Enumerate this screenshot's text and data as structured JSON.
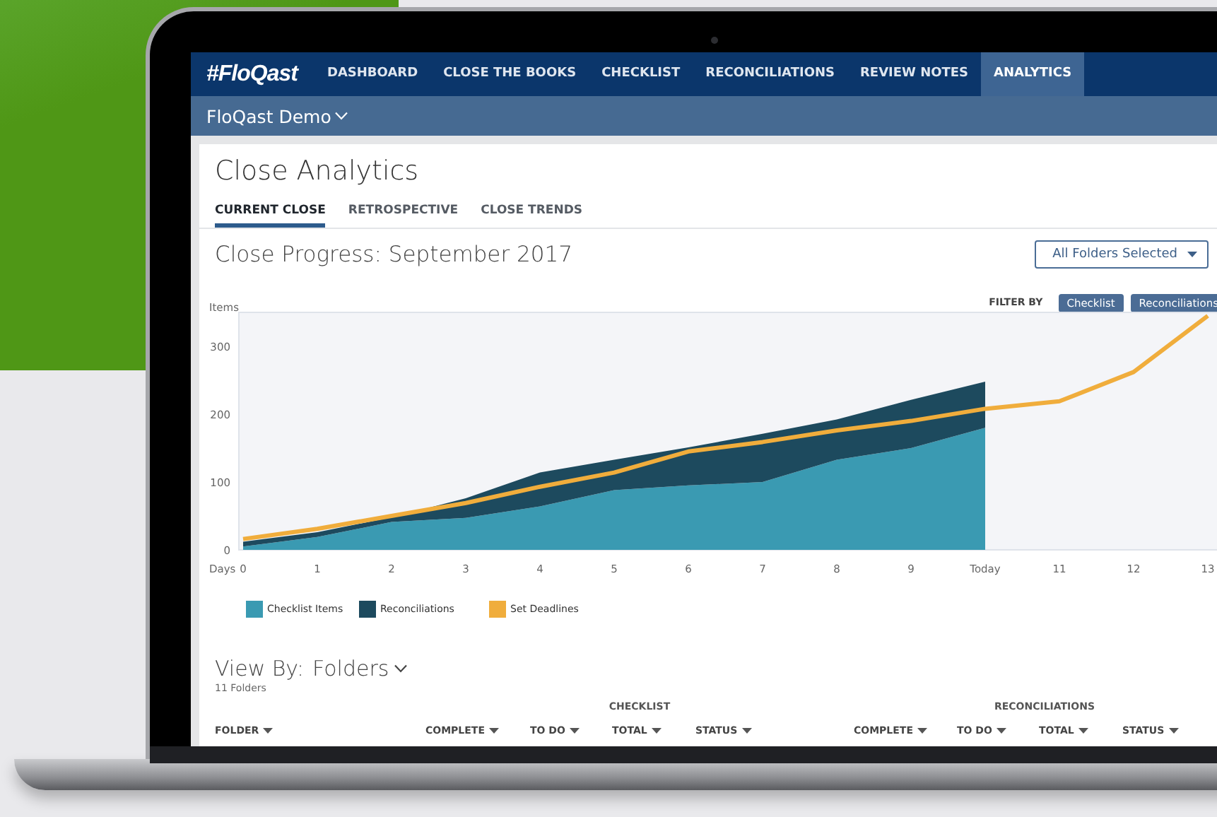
{
  "nav": {
    "logo": "#FloQast",
    "tabs": [
      {
        "label": "DASHBOARD",
        "selected": false
      },
      {
        "label": "CLOSE THE BOOKS",
        "selected": false
      },
      {
        "label": "CHECKLIST",
        "selected": false
      },
      {
        "label": "RECONCILIATIONS",
        "selected": false
      },
      {
        "label": "REVIEW NOTES",
        "selected": false
      },
      {
        "label": "ANALYTICS",
        "selected": true
      }
    ],
    "workspace": "FloQast Demo"
  },
  "page": {
    "title": "Close Analytics",
    "tabs": [
      {
        "label": "CURRENT CLOSE",
        "selected": true
      },
      {
        "label": "RETROSPECTIVE",
        "selected": false
      },
      {
        "label": "CLOSE TRENDS",
        "selected": false
      }
    ]
  },
  "progress": {
    "title": "Close Progress: September 2017",
    "folder_filter": "All Folders Selected",
    "filter_label": "FILTER BY",
    "filter_buttons": [
      "Checklist",
      "Reconciliations"
    ],
    "chart_data": {
      "type": "area",
      "stacked": true,
      "xlabel": "Days",
      "ylabel": "Items",
      "categories": [
        "0",
        "1",
        "2",
        "3",
        "4",
        "5",
        "6",
        "7",
        "8",
        "9",
        "Today",
        "11",
        "12",
        "13"
      ],
      "ylim": [
        0,
        350
      ],
      "legend": "bottom",
      "yticks": [
        0,
        100,
        200,
        300
      ],
      "series": [
        {
          "name": "Checklist Items",
          "color": "#3a9ab2",
          "values": [
            5,
            19,
            41,
            47,
            64,
            88,
            95,
            100,
            133,
            150,
            180,
            null,
            null,
            null
          ]
        },
        {
          "name": "Reconciliations",
          "color": "#1d4a5e",
          "values": [
            7,
            7,
            7,
            29,
            50,
            45,
            56,
            71,
            59,
            71,
            68,
            null,
            null,
            null
          ]
        },
        {
          "name": "Set Deadlines",
          "color": "#f0ad3c",
          "type": "line",
          "values": [
            16,
            31,
            50,
            69,
            93,
            114,
            145,
            159,
            176,
            190,
            208,
            219,
            262,
            345
          ]
        }
      ]
    }
  },
  "view_by": {
    "label": "View By:",
    "value": "Folders",
    "count": "11 Folders"
  },
  "table": {
    "first_column": "FOLDER",
    "groups": [
      {
        "label": "CHECKLIST",
        "columns": [
          "COMPLETE",
          "TO DO",
          "TOTAL",
          "STATUS"
        ]
      },
      {
        "label": "RECONCILIATIONS",
        "columns": [
          "COMPLETE",
          "TO DO",
          "TOTAL",
          "STATUS"
        ]
      }
    ]
  }
}
